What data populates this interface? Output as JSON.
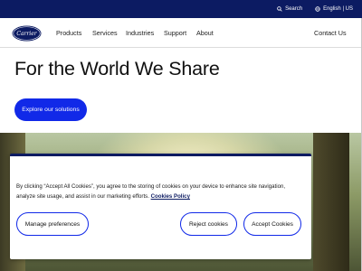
{
  "topbar": {
    "search_label": "Search",
    "language_label": "English | US",
    "search_icon": "search-icon",
    "globe_icon": "globe-icon"
  },
  "nav": {
    "logo_text": "Carrier",
    "items": [
      "Products",
      "Services",
      "Industries",
      "Support",
      "About"
    ],
    "contact": "Contact Us"
  },
  "hero": {
    "title": "For the World We Share",
    "cta_label": "Explore our solutions"
  },
  "cookie_banner": {
    "text": "By clicking “Accept All Cookies”, you agree to the storing of cookies on your device to enhance site navigation, analyze site usage, and assist in our marketing efforts.",
    "link_label": "Cookies Policy",
    "manage_label": "Manage preferences",
    "reject_label": "Reject cookies",
    "accept_label": "Accept Cookies"
  },
  "colors": {
    "brand_navy": "#0c1b62",
    "accent_blue": "#1129e8"
  }
}
